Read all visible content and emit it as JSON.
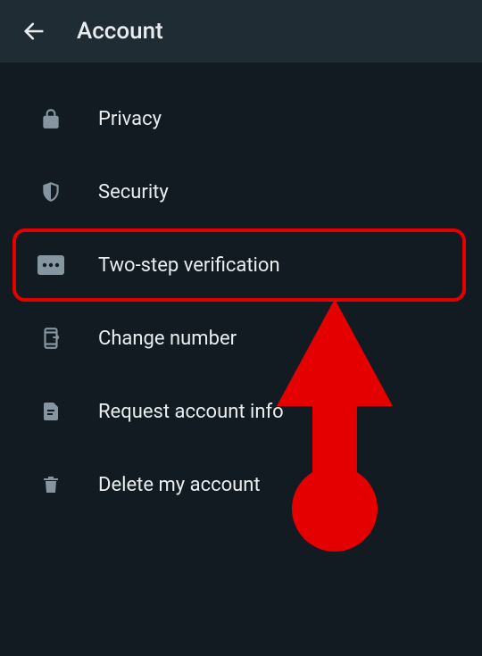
{
  "header": {
    "title": "Account"
  },
  "menu": {
    "items": [
      {
        "label": "Privacy",
        "icon": "lock-icon"
      },
      {
        "label": "Security",
        "icon": "shield-icon"
      },
      {
        "label": "Two-step verification",
        "icon": "password-dots-icon",
        "highlighted": true
      },
      {
        "label": "Change number",
        "icon": "phone-swap-icon"
      },
      {
        "label": "Request account info",
        "icon": "document-icon"
      },
      {
        "label": "Delete my account",
        "icon": "trash-icon"
      }
    ]
  },
  "annotation": {
    "color": "#e50000"
  }
}
